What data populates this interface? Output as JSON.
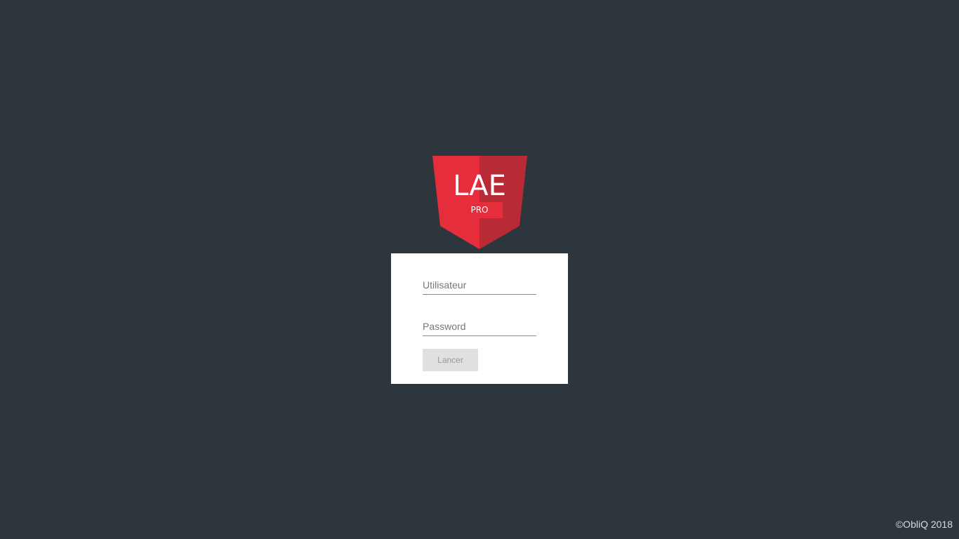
{
  "logo": {
    "title": "LAE",
    "subtitle": "PRO",
    "colors": {
      "left": "#e62d3c",
      "right": "#b82a35"
    }
  },
  "login": {
    "username_placeholder": "Utilisateur",
    "username_value": "",
    "password_placeholder": "Password",
    "password_value": "",
    "submit_label": "Lancer"
  },
  "footer": {
    "copyright": "©ObliQ 2018"
  },
  "colors": {
    "background": "#2d353d",
    "card": "#ffffff",
    "button_bg": "#e0e0e0"
  }
}
